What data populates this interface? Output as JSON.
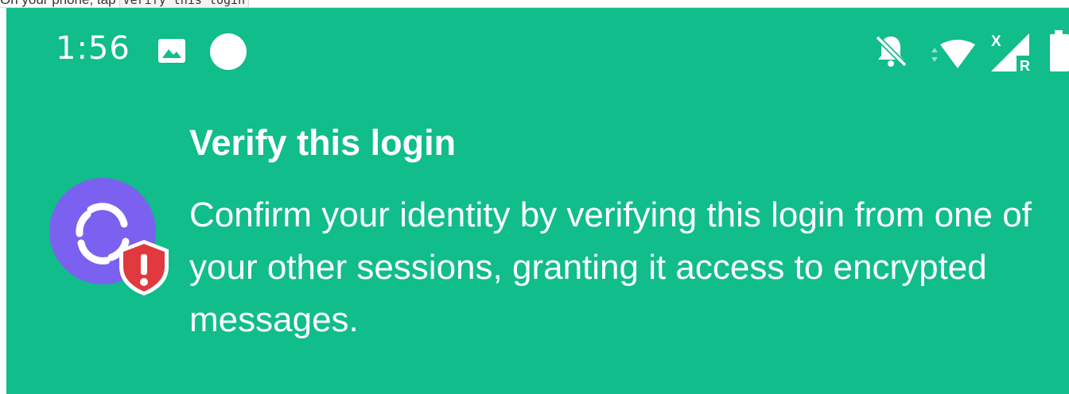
{
  "caption": {
    "text": "On your phone, tap",
    "code": "Verify this login"
  },
  "status_bar": {
    "time": "1:56",
    "icons": [
      "gallery-icon",
      "circle-dot-icon",
      "bell-off-icon",
      "wifi-icon",
      "signal-icon",
      "battery-icon"
    ],
    "signal_x_label": "X",
    "signal_r_label": "R"
  },
  "notification": {
    "title": "Verify this login",
    "body": "Confirm your identity by verifying this login from one of your other sessions, granting it access to encrypted messages.",
    "app_icon": "element-logo-icon",
    "badge_icon": "warning-shield-icon"
  },
  "colors": {
    "background": "#10bd8b",
    "logo": "#7b61f0",
    "shield": "#e0393e",
    "text": "#ffffff"
  }
}
